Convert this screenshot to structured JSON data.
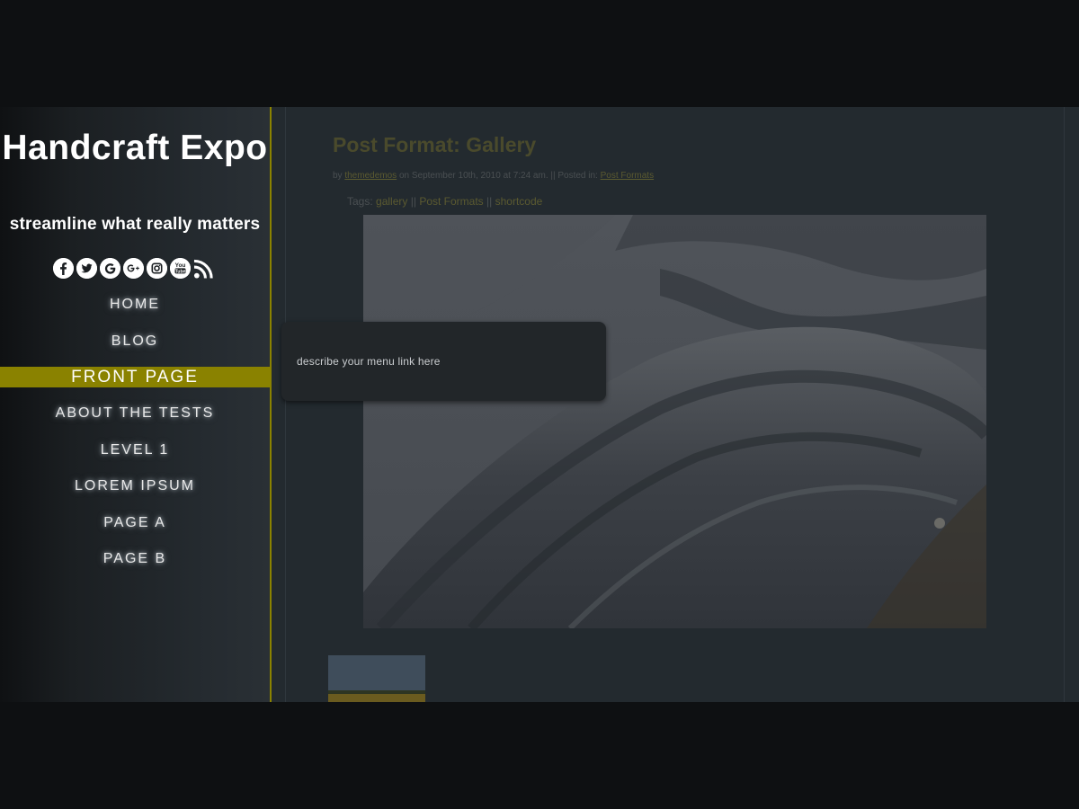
{
  "site": {
    "title": "Handcraft Expo",
    "tagline": "streamline what really matters"
  },
  "social_icons": [
    {
      "icon": "facebook-icon",
      "glyph": "f"
    },
    {
      "icon": "twitter-icon",
      "glyph": "t"
    },
    {
      "icon": "google-icon",
      "glyph": "G"
    },
    {
      "icon": "google-plus-icon",
      "glyph": "g+"
    },
    {
      "icon": "instagram-icon",
      "glyph": "◎"
    },
    {
      "icon": "youtube-icon",
      "glyph": "You Tube"
    },
    {
      "icon": "rss-icon",
      "glyph": ""
    }
  ],
  "nav": {
    "items": [
      {
        "label": "HOME"
      },
      {
        "label": "BLOG"
      },
      {
        "label": "FRONT PAGE",
        "active": true
      },
      {
        "label": "ABOUT THE TESTS"
      },
      {
        "label": "LEVEL 1"
      },
      {
        "label": "LOREM IPSUM"
      },
      {
        "label": "PAGE A"
      },
      {
        "label": "PAGE B"
      }
    ]
  },
  "post": {
    "title": "Post Format: Gallery",
    "meta_by": "by",
    "author": "themedemos",
    "meta_date": "on September 10th, 2010 at 7:24 am. || Posted in:",
    "category": "Post Formats",
    "tags_label": "Tags:",
    "tags": [
      "gallery",
      "Post Formats",
      "shortcode"
    ],
    "tag_separator": "||"
  },
  "tooltip": {
    "text": "describe your menu link here"
  },
  "colors": {
    "accent": "#8a8200",
    "page_bg": "#232a2f",
    "outer_bg": "#0e1012"
  }
}
